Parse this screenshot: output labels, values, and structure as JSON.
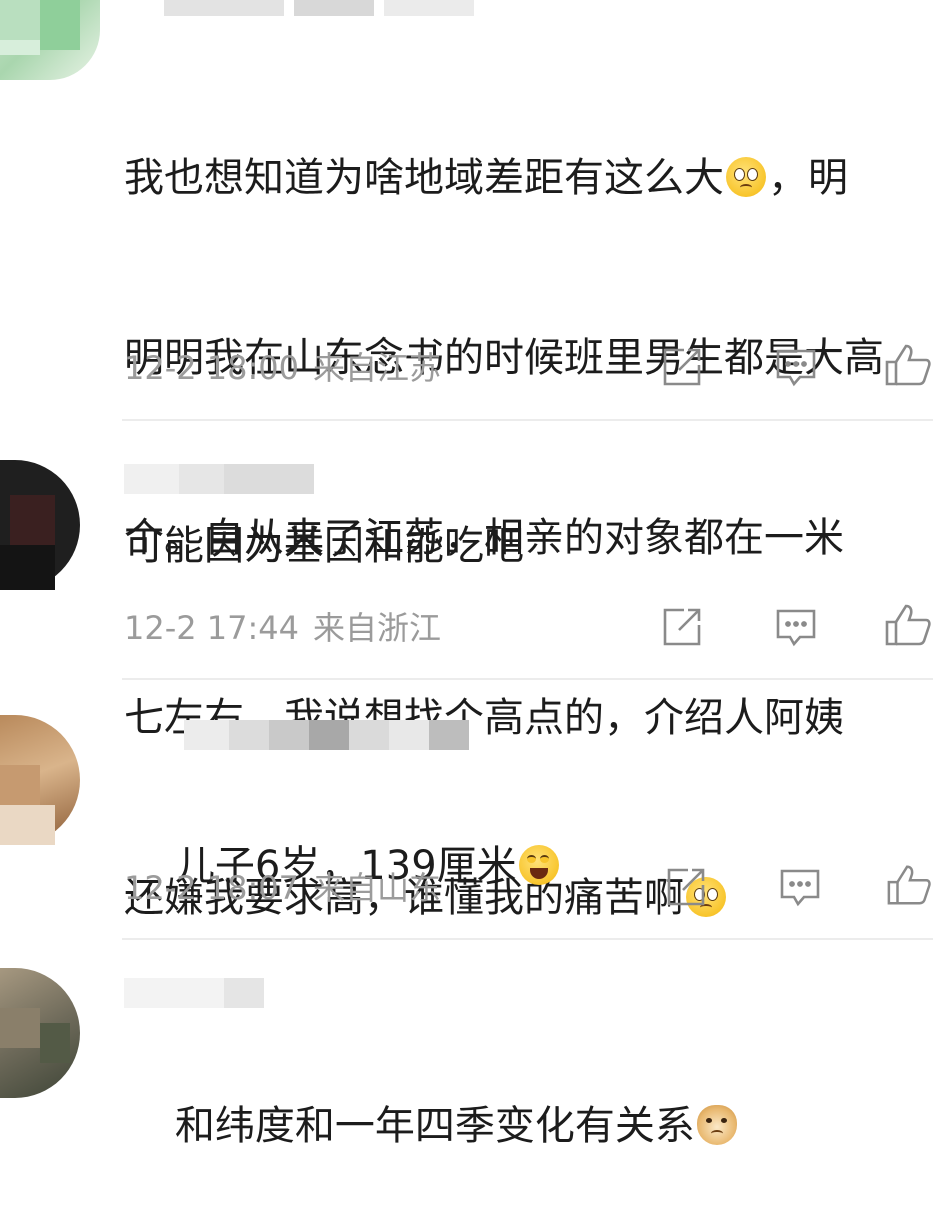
{
  "comments": [
    {
      "username": "…",
      "text_lines": [
        "我也想知道为啥地域差距有这么大",
        "，明",
        "明明我在山东念书的时候班里男生都是大高",
        "个。自从来了江苏，相亲的对象都在一米",
        "七左右，我说想找个高点的，介绍人阿姨",
        "还嫌我要求高，谁懂我的痛苦啊"
      ],
      "time": "12-2 18:00",
      "location": "来自江苏"
    },
    {
      "username": "…不吃草",
      "text": "可能因为基因和能吃吧",
      "time": "12-2 17:44",
      "location": "来自浙江"
    },
    {
      "username": "",
      "text": "儿子6岁，139厘米",
      "time": "12-2 18:07",
      "location": "来自山东"
    },
    {
      "username": "",
      "text": "和纬度和一年四季变化有关系"
    }
  ],
  "icons": {
    "share": "share-icon",
    "comment": "comment-icon",
    "like": "like-icon"
  },
  "colors": {
    "meta_text": "#9b9b9b",
    "body_text": "#1c1c1c",
    "divider": "#ececec"
  }
}
